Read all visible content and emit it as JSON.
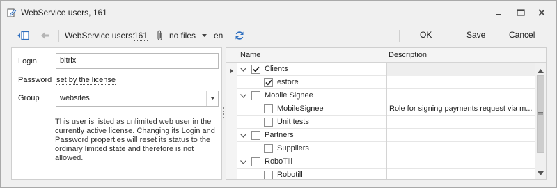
{
  "window": {
    "title": "WebService users, 161",
    "icon": "edit-document-icon"
  },
  "toolbar": {
    "panel_toggle_icon": "toggle-panel-icon",
    "back_icon": "back-arrow-icon",
    "record_label": "WebService users:",
    "record_id": "161",
    "attach_icon": "paperclip-icon",
    "files_label": "no files",
    "language": "en",
    "refresh_icon": "refresh-icon",
    "ok_label": "OK",
    "save_label": "Save",
    "cancel_label": "Cancel"
  },
  "form": {
    "login_label": "Login",
    "login_value": "bitrix",
    "password_label": "Password",
    "password_link": "set by the license",
    "group_label": "Group",
    "group_value": "websites",
    "info_text": "This user is listed as unlimited web user in the currently active license. Changing its Login and Password properties will reset its status to the ordinary limited state and therefore is not allowed."
  },
  "grid": {
    "columns": [
      "Name",
      "Description"
    ],
    "rows": [
      {
        "name": "Clients",
        "description": "",
        "level": 0,
        "expanded": true,
        "checked": true,
        "current": true
      },
      {
        "name": "estore",
        "description": "",
        "level": 1,
        "checked": true
      },
      {
        "name": "Mobile Signee",
        "description": "",
        "level": 0,
        "expanded": true,
        "checked": false
      },
      {
        "name": "MobileSignee",
        "description": "Role for signing payments request via m...",
        "level": 1,
        "checked": false
      },
      {
        "name": "Unit tests",
        "description": "",
        "level": 1,
        "checked": false
      },
      {
        "name": "Partners",
        "description": "",
        "level": 0,
        "expanded": true,
        "checked": false
      },
      {
        "name": "Suppliers",
        "description": "",
        "level": 1,
        "checked": false
      },
      {
        "name": "RoboTill",
        "description": "",
        "level": 0,
        "expanded": true,
        "checked": false
      },
      {
        "name": "Robotill",
        "description": "",
        "level": 1,
        "checked": false
      }
    ]
  },
  "colors": {
    "accent_blue": "#2f6fbf",
    "window_bg": "#f0f0f0",
    "border": "#cfcfcf"
  }
}
